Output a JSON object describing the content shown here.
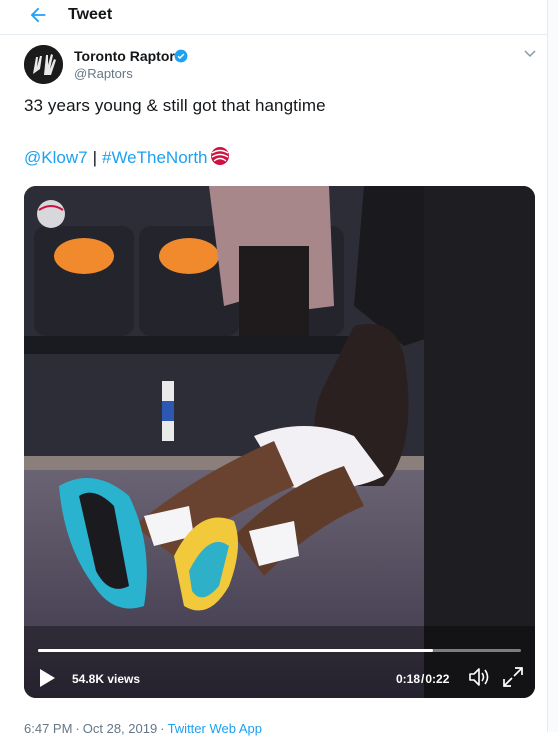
{
  "header": {
    "title": "Tweet",
    "back_icon": "arrow-left-icon"
  },
  "tweet": {
    "author": {
      "name": "Toronto Raptors",
      "handle": "@Raptors",
      "verified": true
    },
    "text": "33 years young & still got that hangtime",
    "mention": "@Klow7",
    "separator": "|",
    "hashtag": "#WeTheNorth",
    "video": {
      "views": "54.8K views",
      "current_time": "0:18",
      "duration": "0:22",
      "time_separator": "/",
      "progress": 0.818
    },
    "meta": {
      "time": "6:47 PM",
      "date": "Oct 28, 2019",
      "dot": "·",
      "source": "Twitter Web App"
    }
  },
  "colors": {
    "accent": "#1da1f2",
    "text": "#14171a",
    "muted": "#657786",
    "raptors_red": "#ce1141"
  }
}
